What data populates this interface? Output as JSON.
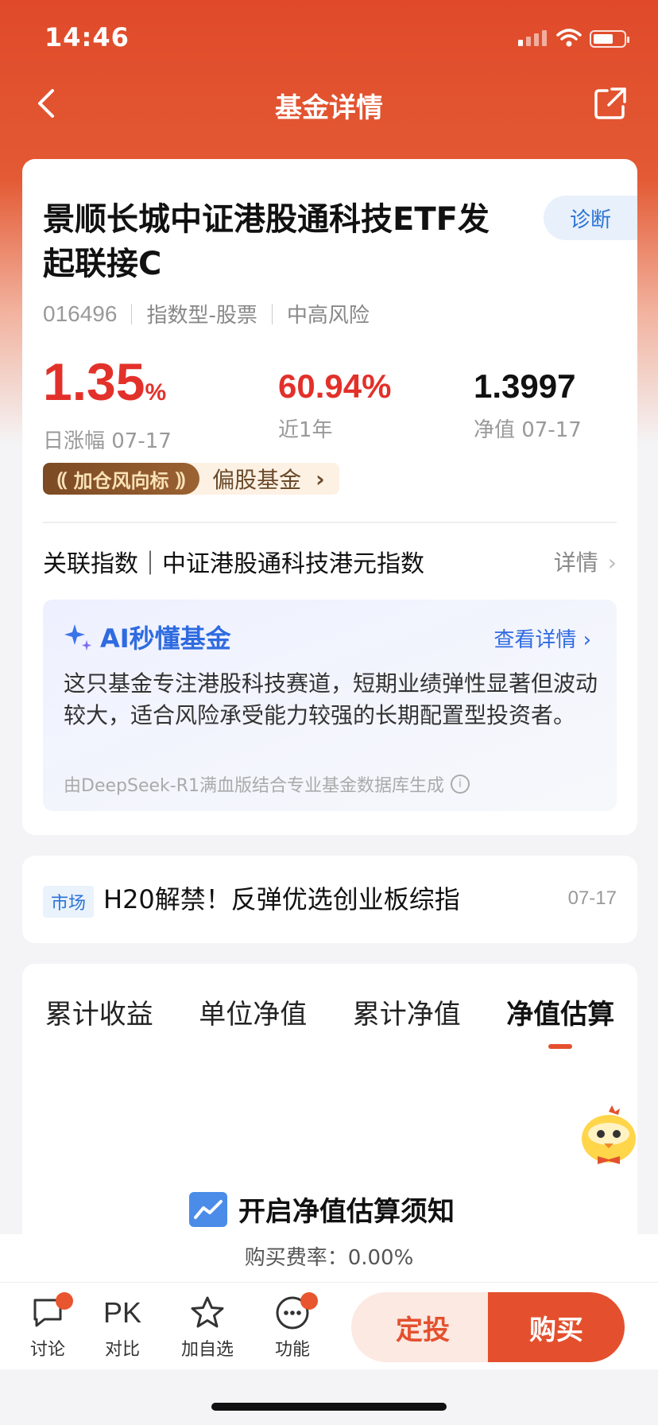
{
  "status_bar": {
    "time": "14:46"
  },
  "nav": {
    "title": "基金详情"
  },
  "fund": {
    "name": "景顺长城中证港股通科技ETF发起联接C",
    "diagnose_label": "诊断",
    "code": "016496",
    "type": "指数型-股票",
    "risk": "中高风险",
    "daily_change": "1.35",
    "daily_change_unit": "%",
    "daily_change_label": "日涨幅 07-17",
    "year_return": "60.94%",
    "year_return_label": "近1年",
    "nav_value": "1.3997",
    "nav_label": "净值 07-17",
    "wind_badge": "加仓风向标",
    "wind_category": "偏股基金"
  },
  "index_row": {
    "label": "关联指数｜中证港股通科技港元指数",
    "more": "详情"
  },
  "ai": {
    "title": "AI秒懂基金",
    "more": "查看详情",
    "text": "这只基金专注港股科技赛道，短期业绩弹性显著但波动较大，适合风险承受能力较强的长期配置型投资者。",
    "source": "由DeepSeek-R1满血版结合专业基金数据库生成"
  },
  "news": {
    "tag": "市场",
    "title": "H20解禁！反弹优选创业板综指",
    "date": "07-17"
  },
  "tabs": [
    "累计收益",
    "单位净值",
    "累计净值",
    "净值估算"
  ],
  "active_tab": 3,
  "estimate_note": "开启净值估算须知",
  "fee": "购买费率：0.00%",
  "toolbar": {
    "discuss": "讨论",
    "compare": "对比",
    "compare_icon_text": "PK",
    "watchlist": "加自选",
    "functions": "功能",
    "plan": "定投",
    "buy": "购买"
  },
  "colors": {
    "brand": "#e4502e",
    "up": "#e2312a",
    "link": "#2f6be0"
  }
}
